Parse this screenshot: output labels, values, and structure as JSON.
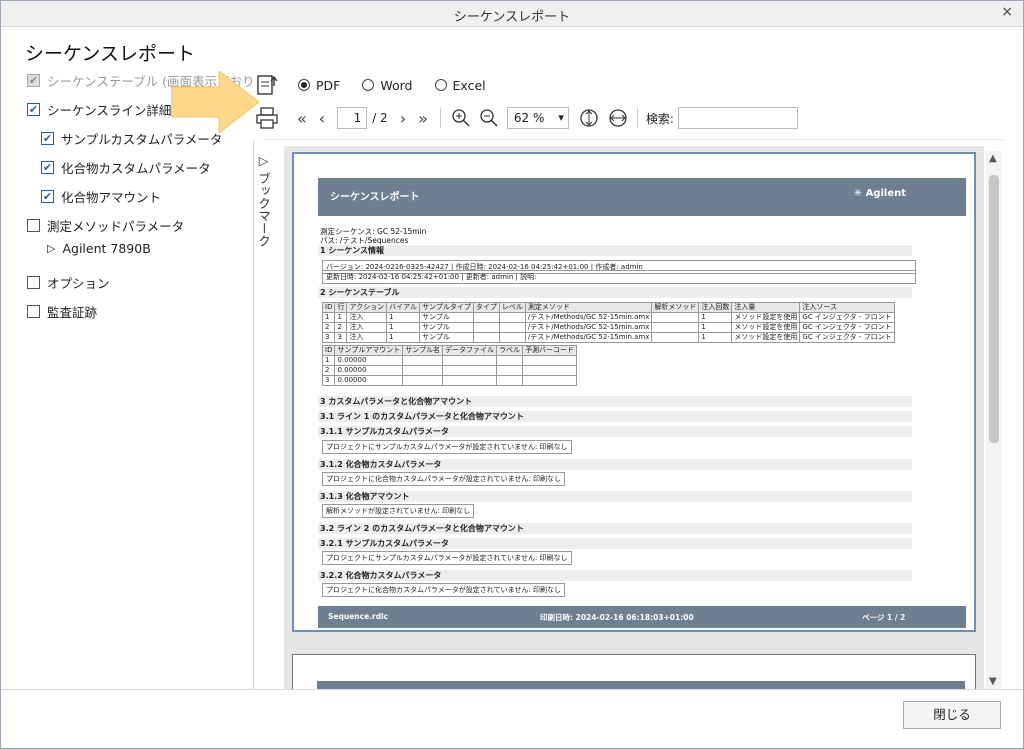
{
  "window": {
    "title": "シーケンスレポート",
    "close_glyph": "×"
  },
  "heading": "シーケンスレポート",
  "options": {
    "sequence_table": "シーケンステーブル (画面表示どおり",
    "sequence_line_detail": "シーケンスライン詳細",
    "sample_custom_params": "サンプルカスタムパラメータ",
    "compound_custom_params": "化合物カスタムパラメータ",
    "compound_amount": "化合物アマウント",
    "method_params": "測定メソッドパラメータ",
    "instrument": "Agilent 7890B",
    "options": "オプション",
    "audit_trail": "監査証跡"
  },
  "export": {
    "pdf": "PDF",
    "word": "Word",
    "excel": "Excel",
    "selected": "PDF"
  },
  "nav": {
    "page": "1",
    "total": "/ 2",
    "zoom": "62 %",
    "search_label": "検索:"
  },
  "bookmark_label": "ブックマーク",
  "report": {
    "header_title": "シーケンスレポート",
    "brand": "Agilent",
    "meta1": "測定シーケンス:  GC 52-15min",
    "meta2": "パス:                    /テスト/Sequences",
    "s1": "1 シーケンス情報",
    "info_row1": "バージョン:                  2024-0216-0325-42427 | 作成日時:                  2024-02-16 04:25:42+01:00 | 作成者:                                                 admin",
    "info_row2": "更新日時:              2024-02-16 04:25:42+01:00 | 更新者:                                              admin | 説明:",
    "s2": "2 シーケンステーブル",
    "t1_headers": [
      "ID",
      "行",
      "アクション",
      "バイアル",
      "サンプルタイプ",
      "タイプ",
      "レベル",
      "測定メソッド",
      "解析メソッド",
      "注入回数",
      "注入量",
      "注入ソース"
    ],
    "t1_rows": [
      [
        "1",
        "1",
        "注入",
        "1",
        "サンプル",
        "",
        "",
        "/テスト/Methods/GC 52-15min.amx",
        "",
        "1",
        "メソッド設定を使用",
        "GC インジェクタ - フロント"
      ],
      [
        "2",
        "2",
        "注入",
        "1",
        "サンプル",
        "",
        "",
        "/テスト/Methods/GC 52-15min.amx",
        "",
        "1",
        "メソッド設定を使用",
        "GC インジェクタ - フロント"
      ],
      [
        "3",
        "3",
        "注入",
        "1",
        "サンプル",
        "",
        "",
        "/テスト/Methods/GC 52-15min.amx",
        "",
        "1",
        "メソッド設定を使用",
        "GC インジェクタ - フロント"
      ]
    ],
    "t2_headers": [
      "ID",
      "サンプルアマウント",
      "サンプル名",
      "データファイル",
      "ラベル",
      "予測バーコード"
    ],
    "t2_rows": [
      [
        "1",
        "0.00000",
        "",
        "",
        "",
        ""
      ],
      [
        "2",
        "0.00000",
        "",
        "",
        "",
        ""
      ],
      [
        "3",
        "0.00000",
        "",
        "",
        "",
        ""
      ]
    ],
    "s3": "3 カスタムパラメータと化合物アマウント",
    "s31": "3.1 ライン 1 のカスタムパラメータと化合物アマウント",
    "s311": "3.1.1 サンプルカスタムパラメータ",
    "b311": "プロジェクトにサンプルカスタムパラメータが設定されていません:    印刷なし",
    "s312": "3.1.2 化合物カスタムパラメータ",
    "b312": "プロジェクトに化合物カスタムパラメータが設定されていません:    印刷なし",
    "s313": "3.1.3 化合物アマウント",
    "b313": "解析メソッドが設定されていません:                          印刷なし",
    "s32": "3.2 ライン 2 のカスタムパラメータと化合物アマウント",
    "s321": "3.2.1 サンプルカスタムパラメータ",
    "b321": "プロジェクトにサンプルカスタムパラメータが設定されていません:    印刷なし",
    "s322": "3.2.2 化合物カスタムパラメータ",
    "b322": "プロジェクトに化合物カスタムパラメータが設定されていません:    印刷なし",
    "footer_file": "Sequence.rdlc",
    "footer_printed": "印刷日時: 2024-02-16 06:18:03+01:00",
    "footer_page": "ページ 1 / 2"
  },
  "close_button": "閉じる",
  "colors": {
    "arrow": "#fdd88a",
    "band": "#6e7f91",
    "accent": "#2a5da8"
  }
}
